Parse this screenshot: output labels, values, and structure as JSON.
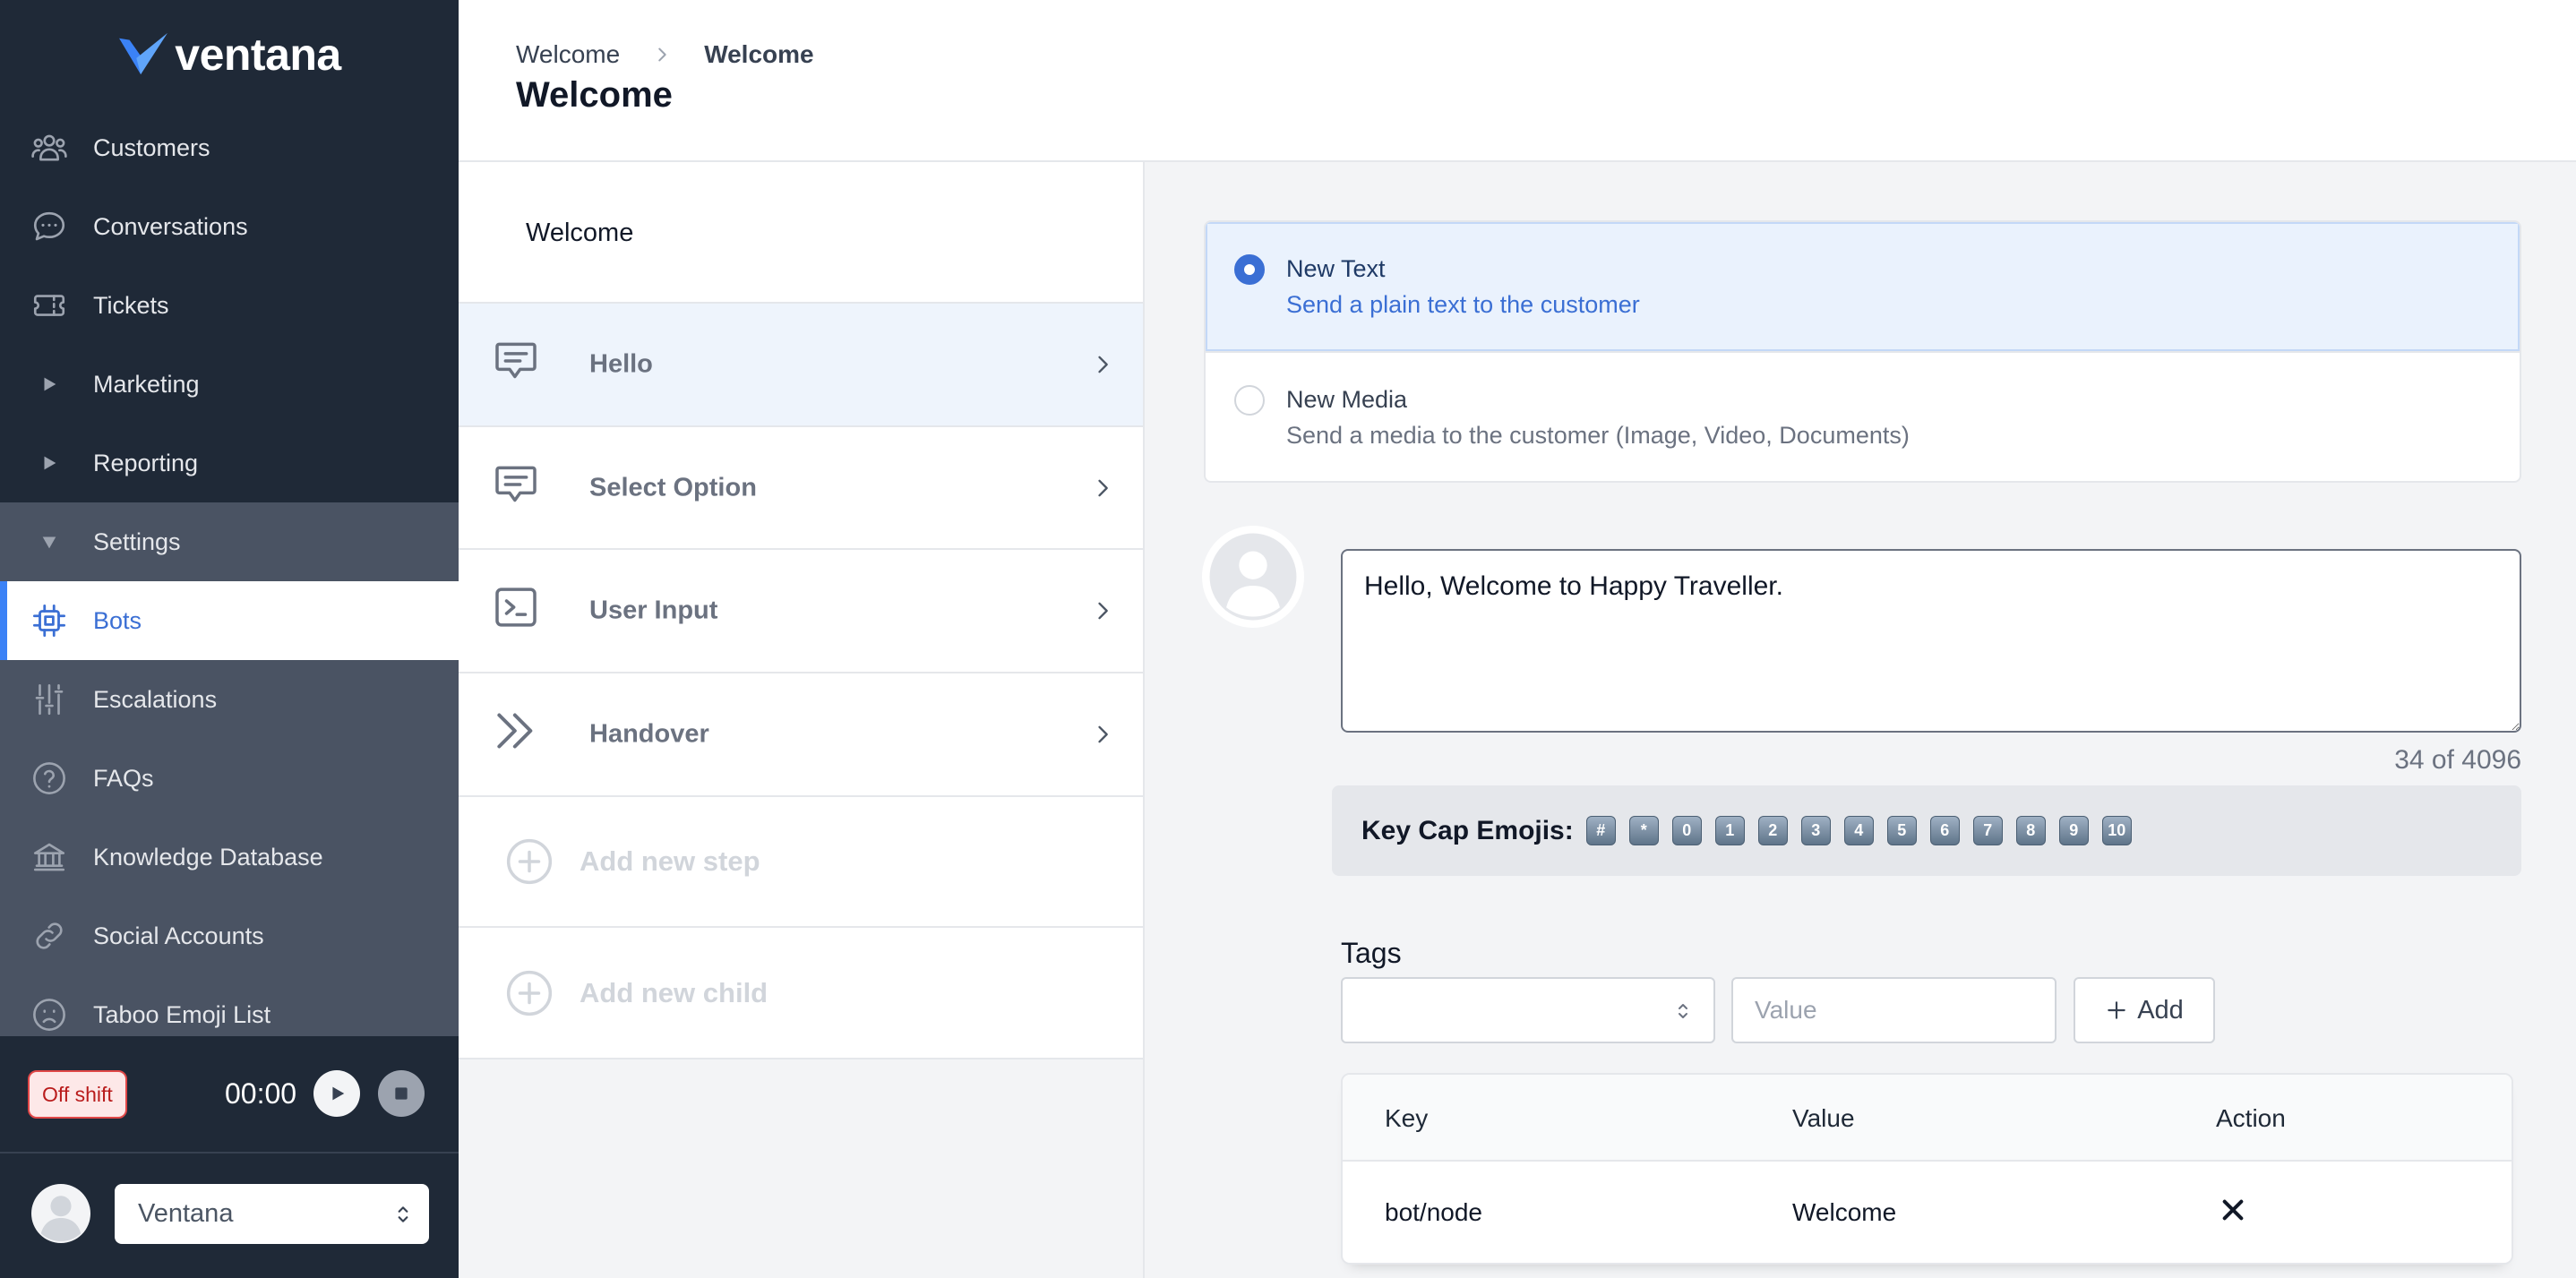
{
  "app": {
    "logo_text": "ventana"
  },
  "theme": {
    "accent": "#3b6fd4",
    "sidebar_bg": "#1f2937",
    "off_shift": "#dc2626"
  },
  "sidebar": {
    "items": [
      {
        "label": "Customers",
        "icon": "users-icon"
      },
      {
        "label": "Conversations",
        "icon": "chat-icon"
      },
      {
        "label": "Tickets",
        "icon": "ticket-icon"
      },
      {
        "label": "Marketing",
        "icon": "caret-right-icon",
        "expanded": false
      },
      {
        "label": "Reporting",
        "icon": "caret-right-icon",
        "expanded": false
      },
      {
        "label": "Settings",
        "icon": "caret-down-icon",
        "expanded": true
      },
      {
        "label": "Bots",
        "icon": "chip-icon",
        "active": true
      },
      {
        "label": "Escalations",
        "icon": "sliders-icon"
      },
      {
        "label": "FAQs",
        "icon": "question-circle-icon"
      },
      {
        "label": "Knowledge Database",
        "icon": "bank-icon"
      },
      {
        "label": "Social Accounts",
        "icon": "link-icon"
      },
      {
        "label": "Taboo Emoji List",
        "icon": "sad-face-icon"
      }
    ],
    "shift": {
      "status": "Off shift",
      "timer": "00:00"
    },
    "user": {
      "name": "Ventana"
    }
  },
  "header": {
    "breadcrumb": [
      "Welcome",
      "Welcome"
    ],
    "title": "Welcome"
  },
  "steps": {
    "heading": "Welcome",
    "items": [
      {
        "label": "Hello",
        "icon": "message-icon",
        "active": true
      },
      {
        "label": "Select Option",
        "icon": "message-icon"
      },
      {
        "label": "User Input",
        "icon": "terminal-icon"
      },
      {
        "label": "Handover",
        "icon": "double-chevron-icon"
      }
    ],
    "add_step": "Add new step",
    "add_child": "Add new child"
  },
  "editor": {
    "message_types": [
      {
        "title": "New Text",
        "description": "Send a plain text to the customer",
        "selected": true
      },
      {
        "title": "New Media",
        "description": "Send a media to the customer (Image, Video, Documents)",
        "selected": false
      }
    ],
    "message": "Hello, Welcome to Happy Traveller.",
    "char_count": "34 of 4096",
    "keycaps": {
      "label": "Key Cap Emojis:",
      "keys": [
        "#",
        "*",
        "0",
        "1",
        "2",
        "3",
        "4",
        "5",
        "6",
        "7",
        "8",
        "9",
        "10"
      ]
    },
    "tags": {
      "label": "Tags",
      "value_placeholder": "Value",
      "add_label": "Add",
      "columns": [
        "Key",
        "Value",
        "Action"
      ],
      "rows": [
        {
          "key": "bot/node",
          "value": "Welcome"
        }
      ]
    }
  }
}
